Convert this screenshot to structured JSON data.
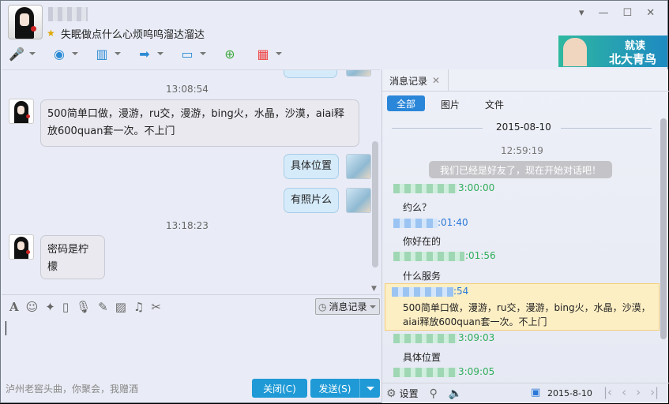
{
  "header": {
    "contact_name": "(blurred)",
    "signature": "失眠做点什么心烦呜呜溜达溜达",
    "ad_line1": "就读",
    "ad_line2": "北大青鸟"
  },
  "toolbar": [
    "voice-icon",
    "video-icon",
    "screen-share-icon",
    "file-transfer-icon",
    "remote-desktop-icon",
    "add-chat-icon",
    "apps-icon"
  ],
  "chat": {
    "partial_top": "",
    "messages": [
      {
        "type": "time",
        "text": "13:08:54"
      },
      {
        "type": "in",
        "text": "500简单口做，漫游，ru交，漫游，bing火，水晶，沙漠，aiai释放600quan套一次。不上门"
      },
      {
        "type": "out",
        "text": "具体位置"
      },
      {
        "type": "out",
        "text": "有照片么"
      },
      {
        "type": "time",
        "text": "13:18:23"
      },
      {
        "type": "in",
        "text": "密码是柠檬"
      }
    ]
  },
  "input_toolbar": {
    "history_label": "消息记录"
  },
  "footer": {
    "ad_text": "泸州老窖头曲，你聚会，我赠酒",
    "close_label": "关闭(C)",
    "send_label": "发送(S)"
  },
  "history": {
    "tab_label": "消息记录",
    "filters": [
      "全部",
      "图片",
      "文件"
    ],
    "date": "2015-08-10",
    "first_time": "12:59:19",
    "system_msg": "我们已经是好友了，现在开始对话吧！",
    "entries": [
      {
        "time": "3:00:00",
        "color": "green",
        "text": "约么？"
      },
      {
        "time": ":01:40",
        "color": "blue",
        "text": "你好在的"
      },
      {
        "time": ":01:56",
        "color": "green",
        "text": "什么服务"
      },
      {
        "time": ":54",
        "color": "blue",
        "text": "500简单口做，漫游，ru交，漫游，bing火，水晶，沙漠，aiai释放600quan套一次。不上门",
        "highlight": true
      },
      {
        "time": "3:09:03",
        "color": "green",
        "text": "具体位置"
      },
      {
        "time": "3:09:05",
        "color": "green",
        "text": ""
      }
    ],
    "settings_label": "设置",
    "footer_date": "2015-8-10"
  }
}
